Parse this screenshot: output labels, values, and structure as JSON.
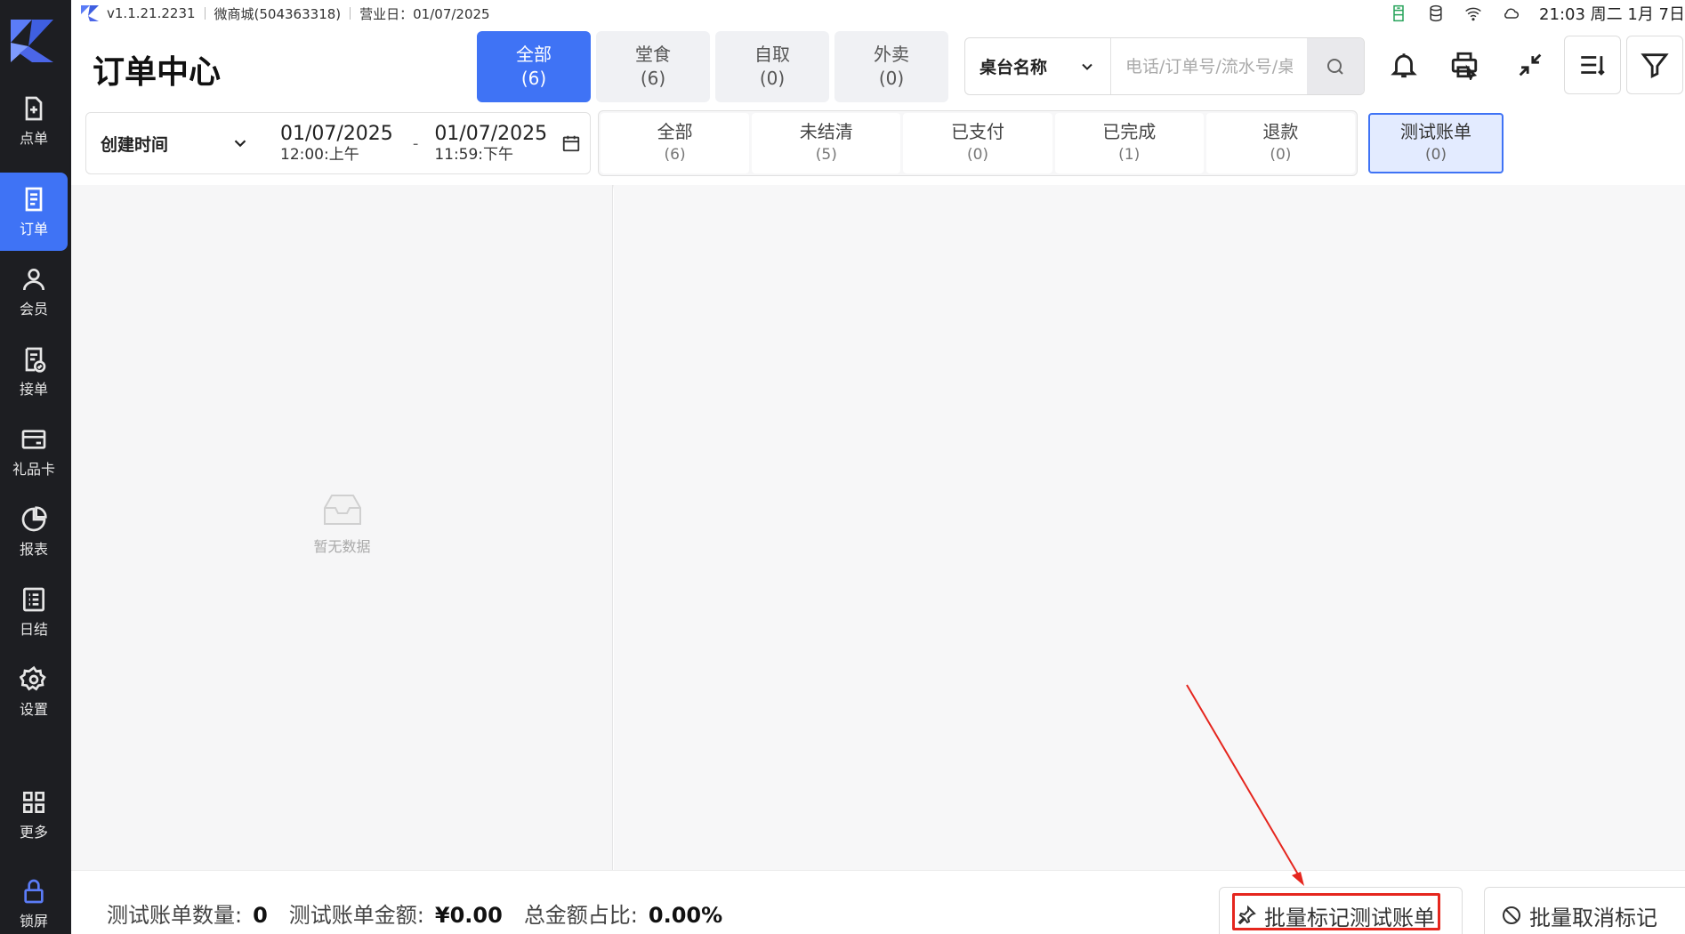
{
  "status_bar": {
    "version": "v1.1.21.2231",
    "store": "微商城(504363318)",
    "business_day": "营业日：01/07/2025",
    "clock": "21:03 周二 1月 7日"
  },
  "sidebar": {
    "items": [
      {
        "label": "点单",
        "icon": "add-order-icon"
      },
      {
        "label": "订单",
        "icon": "order-list-icon"
      },
      {
        "label": "会员",
        "icon": "user-icon"
      },
      {
        "label": "接单",
        "icon": "accept-order-icon"
      },
      {
        "label": "礼品卡",
        "icon": "gift-card-icon"
      },
      {
        "label": "报表",
        "icon": "pie-chart-icon"
      },
      {
        "label": "日结",
        "icon": "daily-settle-icon"
      },
      {
        "label": "设置",
        "icon": "gear-icon"
      },
      {
        "label": "更多",
        "icon": "grid-icon"
      },
      {
        "label": "锁屏",
        "icon": "lock-icon"
      }
    ]
  },
  "header": {
    "title": "订单中心",
    "type_tabs": [
      {
        "label": "全部",
        "count": "(6)"
      },
      {
        "label": "堂食",
        "count": "(6)"
      },
      {
        "label": "自取",
        "count": "(0)"
      },
      {
        "label": "外卖",
        "count": "(0)"
      }
    ],
    "search": {
      "field_select": "桌台名称",
      "placeholder": "电话/订单号/流水号/桌台名称"
    }
  },
  "filter": {
    "date_type": "创建时间",
    "start_date": "01/07/2025",
    "start_time": "12:00:上午",
    "separator": "-",
    "end_date": "01/07/2025",
    "end_time": "11:59:下午",
    "status_tabs": [
      {
        "label": "全部",
        "count": "(6)"
      },
      {
        "label": "未结清",
        "count": "(5)"
      },
      {
        "label": "已支付",
        "count": "(0)"
      },
      {
        "label": "已完成",
        "count": "(1)"
      },
      {
        "label": "退款",
        "count": "(0)"
      }
    ],
    "test_tab": {
      "label": "测试账单",
      "count": "(0)"
    }
  },
  "empty_state": {
    "text": "暂无数据"
  },
  "footer": {
    "test_count_label": "测试账单数量:",
    "test_count_value": "0",
    "test_amount_label": "测试账单金额:",
    "test_amount_value": "¥0.00",
    "ratio_label": "总金额占比:",
    "ratio_value": "0.00%",
    "mark_button": "批量标记测试账单",
    "unmark_button": "批量取消标记"
  },
  "colors": {
    "accent": "#3f73f5",
    "sidebar_bg": "#1d1e22",
    "annotation": "#e5261e"
  }
}
